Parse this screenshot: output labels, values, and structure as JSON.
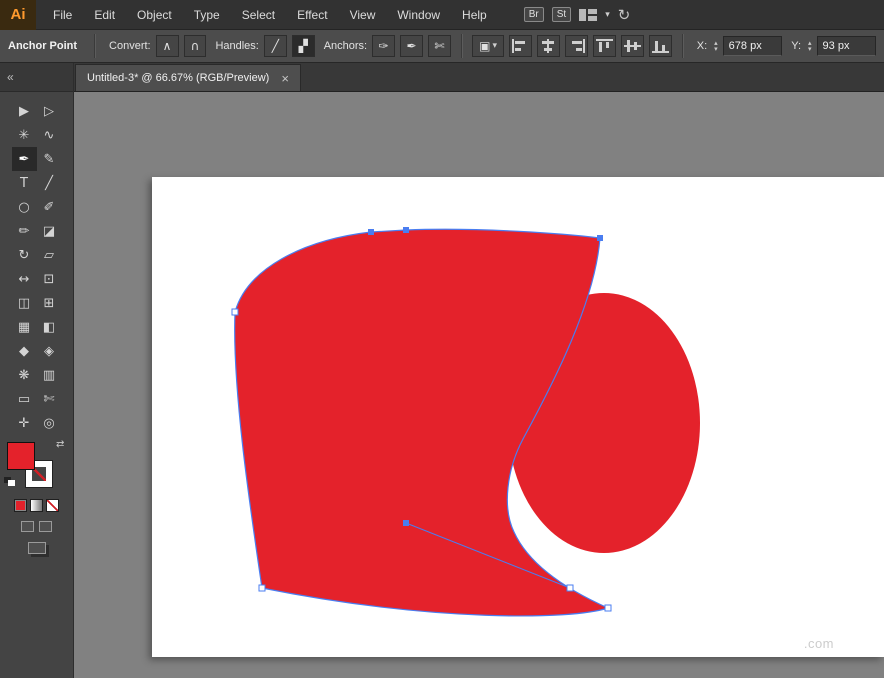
{
  "menubar": {
    "logo": "Ai",
    "items": [
      "File",
      "Edit",
      "Object",
      "Type",
      "Select",
      "Effect",
      "View",
      "Window",
      "Help"
    ],
    "bridge_label": "Br",
    "stock_label": "St"
  },
  "control": {
    "context_label": "Anchor Point",
    "convert_label": "Convert:",
    "handles_label": "Handles:",
    "anchors_label": "Anchors:",
    "x_label": "X:",
    "x_value": "678 px",
    "y_label": "Y:",
    "y_value": "93 px"
  },
  "tab": {
    "title": "Untitled-3* @ 66.67% (RGB/Preview)"
  },
  "icons": {
    "close": "×",
    "collapse": "«",
    "swap": "⇄",
    "sync": "↻",
    "chevron_down": "▾",
    "stepper_up": "▴",
    "stepper_down": "▾",
    "convert_corner": "∧",
    "convert_smooth": "∩",
    "handles_show": "╱",
    "handles_hide": "▞",
    "anchor_remove": "✑",
    "anchor_connect": "✒",
    "anchor_cut": "✄",
    "transform_menu": "▣"
  },
  "toolbar": {
    "tools": [
      {
        "name": "selection-tool",
        "glyph": "▶"
      },
      {
        "name": "direct-selection-tool",
        "glyph": "▷"
      },
      {
        "name": "magic-wand-tool",
        "glyph": "✳"
      },
      {
        "name": "lasso-tool",
        "glyph": "∿"
      },
      {
        "name": "pen-tool",
        "glyph": "✒"
      },
      {
        "name": "add-anchor-point-tool",
        "glyph": "✎"
      },
      {
        "name": "type-tool",
        "glyph": "T"
      },
      {
        "name": "line-segment-tool",
        "glyph": "╱"
      },
      {
        "name": "ellipse-tool",
        "glyph": "○"
      },
      {
        "name": "paintbrush-tool",
        "glyph": "✐"
      },
      {
        "name": "pencil-tool",
        "glyph": "✏"
      },
      {
        "name": "eraser-tool",
        "glyph": "◪"
      },
      {
        "name": "rotate-tool",
        "glyph": "↻"
      },
      {
        "name": "scale-tool",
        "glyph": "▱"
      },
      {
        "name": "width-tool",
        "glyph": "↔"
      },
      {
        "name": "free-transform-tool",
        "glyph": "⊡"
      },
      {
        "name": "shape-builder-tool",
        "glyph": "◫"
      },
      {
        "name": "perspective-grid-tool",
        "glyph": "⊞"
      },
      {
        "name": "mesh-tool",
        "glyph": "▦"
      },
      {
        "name": "gradient-tool",
        "glyph": "◧"
      },
      {
        "name": "eyedropper-tool",
        "glyph": "◆"
      },
      {
        "name": "blend-tool",
        "glyph": "◈"
      },
      {
        "name": "symbol-sprayer-tool",
        "glyph": "❋"
      },
      {
        "name": "column-graph-tool",
        "glyph": "▥"
      },
      {
        "name": "artboard-tool",
        "glyph": "▭"
      },
      {
        "name": "slice-tool",
        "glyph": "✄"
      },
      {
        "name": "hand-tool",
        "glyph": "✛"
      },
      {
        "name": "zoom-tool",
        "glyph": "◎"
      }
    ]
  },
  "artboard": {
    "watermark": ".com"
  },
  "colors": {
    "shape_fill": "#e4222b",
    "selection_blue": "#4a7df0",
    "anchor_fill_white": "#ffffff"
  }
}
